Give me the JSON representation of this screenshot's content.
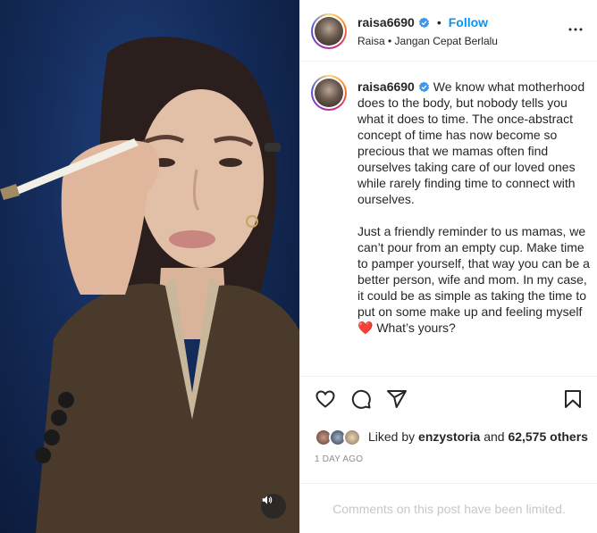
{
  "post": {
    "username": "raisa6690",
    "follow_label": "Follow",
    "separator": "•",
    "location": "Raisa • Jangan Cepat Berlalu",
    "caption_paragraphs": [
      "We know what motherhood does to the body, but nobody tells you what it does to time. The once-abstract concept of time has now become so precious that we mamas often find ourselves taking care of our loved ones while rarely finding time to connect with ourselves.",
      "Just a friendly reminder to us mamas, we can’t pour from an empty cup. Make time to pamper yourself, that way you can be a better person, wife and mom. In my case, it could be as simple as taking the time to put on some make up and feeling myself ❤️ What’s yours?"
    ],
    "liked_prefix": "Liked by",
    "liked_user": "enzystoria",
    "liked_and": "and",
    "liked_count": "62,575 others",
    "time_ago": "1 DAY AGO",
    "comments_limited": "Comments on this post have been limited."
  },
  "colors": {
    "link_blue": "#0095f6",
    "verified_blue": "#3897f0",
    "muted": "#8e8e8e",
    "limited_text": "#c7c7c7",
    "video_bg": "#142b59"
  },
  "icons": {
    "verified": "verified-badge-icon",
    "more": "more-options-icon",
    "like": "heart-icon",
    "comment": "comment-icon",
    "share": "share-icon",
    "save": "bookmark-icon",
    "audio": "speaker-icon"
  }
}
